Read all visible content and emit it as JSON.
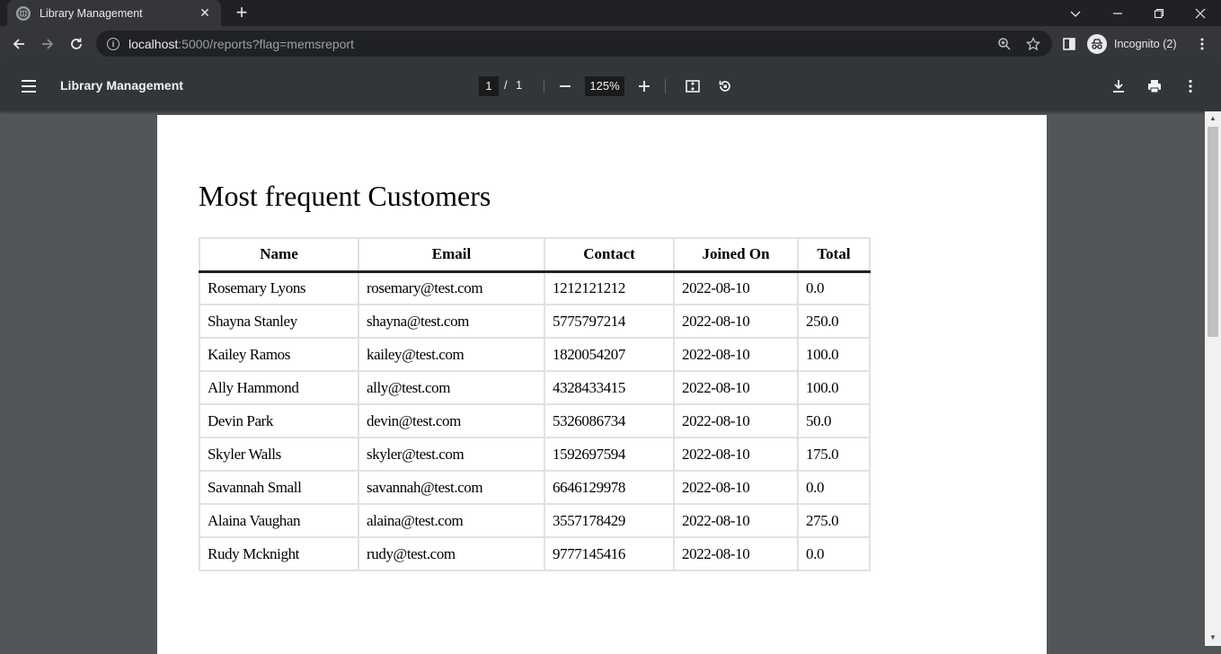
{
  "browser": {
    "tab_title": "Library Management",
    "url_host": "localhost",
    "url_rest": ":5000/reports?flag=memsreport",
    "profile_label": "Incognito (2)"
  },
  "viewer": {
    "title": "Library Management",
    "current_page": "1",
    "page_separator": "/",
    "total_pages": "1",
    "zoom": "125%"
  },
  "report": {
    "heading": "Most frequent Customers",
    "columns": [
      "Name",
      "Email",
      "Contact",
      "Joined On",
      "Total"
    ],
    "rows": [
      [
        "Rosemary Lyons",
        "rosemary@test.com",
        "1212121212",
        "2022-08-10",
        "0.0"
      ],
      [
        "Shayna Stanley",
        "shayna@test.com",
        "5775797214",
        "2022-08-10",
        "250.0"
      ],
      [
        "Kailey Ramos",
        "kailey@test.com",
        "1820054207",
        "2022-08-10",
        "100.0"
      ],
      [
        "Ally Hammond",
        "ally@test.com",
        "4328433415",
        "2022-08-10",
        "100.0"
      ],
      [
        "Devin Park",
        "devin@test.com",
        "5326086734",
        "2022-08-10",
        "50.0"
      ],
      [
        "Skyler Walls",
        "skyler@test.com",
        "1592697594",
        "2022-08-10",
        "175.0"
      ],
      [
        "Savannah Small",
        "savannah@test.com",
        "6646129978",
        "2022-08-10",
        "0.0"
      ],
      [
        "Alaina Vaughan",
        "alaina@test.com",
        "3557178429",
        "2022-08-10",
        "275.0"
      ],
      [
        "Rudy Mcknight",
        "rudy@test.com",
        "9777145416",
        "2022-08-10",
        "0.0"
      ]
    ]
  },
  "colors": {
    "tabstrip": "#202124",
    "toolbar": "#35363a",
    "pdf_toolbar": "#323639",
    "viewer_background": "#525659"
  }
}
